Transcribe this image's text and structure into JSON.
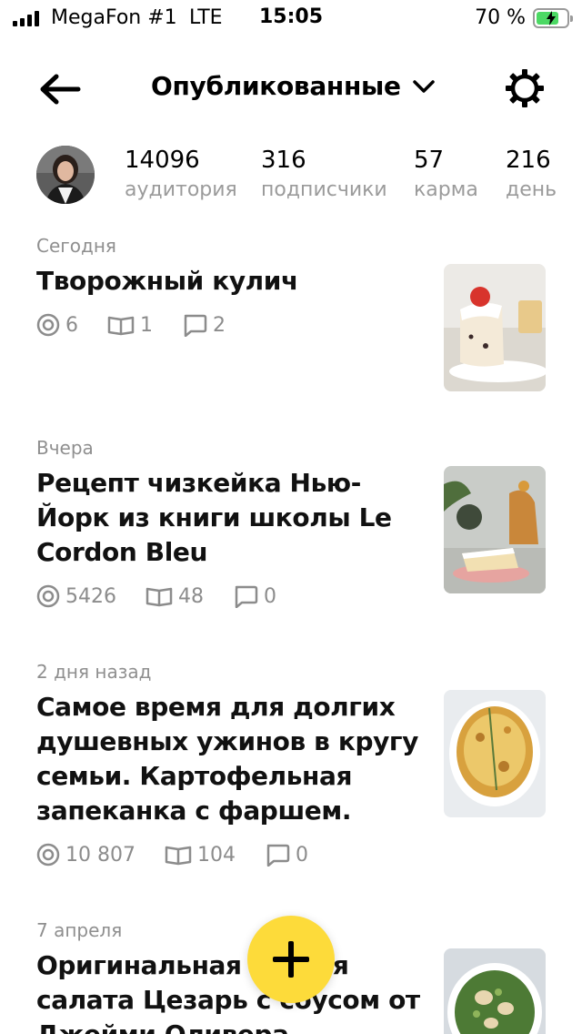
{
  "status_bar": {
    "carrier": "MegaFon #1",
    "network": "LTE",
    "time": "15:05",
    "battery_percent": "70 %",
    "battery_level": 0.7,
    "signal_bars": 4
  },
  "header": {
    "title": "Опубликованные",
    "icons": [
      "arrow-left-icon",
      "chevron-down-icon",
      "gear-icon"
    ]
  },
  "profile": {
    "stats": [
      {
        "value": "14096",
        "label": "аудитория"
      },
      {
        "value": "316",
        "label": "подписчики"
      },
      {
        "value": "57",
        "label": "карма"
      },
      {
        "value": "216",
        "label": "день"
      }
    ]
  },
  "articles": [
    {
      "date": "Сегодня",
      "title": "Творожный кулич",
      "views": "6",
      "reads": "1",
      "comments": "2"
    },
    {
      "date": "Вчера",
      "title": "Рецепт чизкейка Нью-Йорк из книги школы Le Cordon Bleu",
      "views": "5426",
      "reads": "48",
      "comments": "0"
    },
    {
      "date": "2 дня назад",
      "title": "Самое время для долгих душевных ужинов в кругу семьи. Картофельная запеканка с фаршем.",
      "views": "10 807",
      "reads": "104",
      "comments": "0"
    },
    {
      "date": "7 апреля",
      "title": "Оригинальная версия салата Цезарь с соусом от Джейми Оливера",
      "views": "",
      "reads": "",
      "comments": ""
    }
  ],
  "fab": {
    "icon": "plus-icon"
  },
  "colors": {
    "accent": "#fddb3a",
    "muted_text": "#8c8c8c",
    "battery": "#4cd964"
  }
}
